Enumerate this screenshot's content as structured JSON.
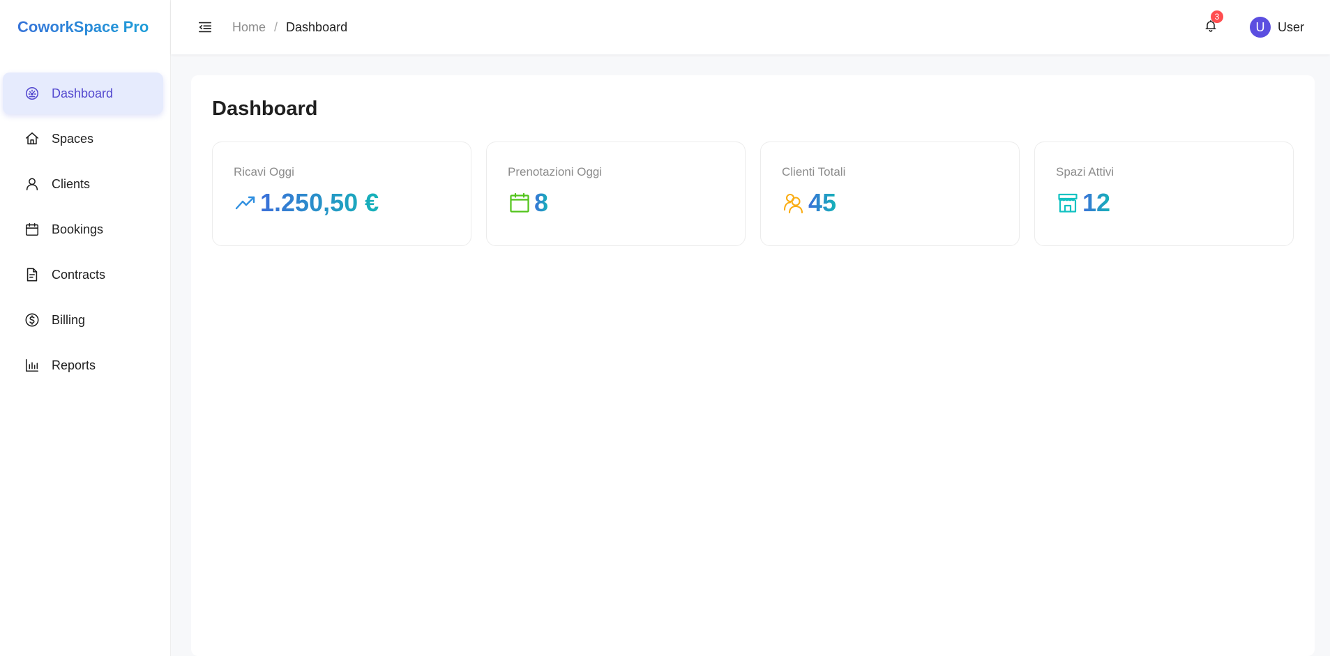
{
  "app": {
    "brand": "CoworkSpace Pro"
  },
  "sidebar": {
    "items": [
      {
        "label": "Dashboard",
        "icon": "dashboard-gauge-icon",
        "active": true
      },
      {
        "label": "Spaces",
        "icon": "home-icon"
      },
      {
        "label": "Clients",
        "icon": "user-icon"
      },
      {
        "label": "Bookings",
        "icon": "calendar-icon"
      },
      {
        "label": "Contracts",
        "icon": "document-icon"
      },
      {
        "label": "Billing",
        "icon": "dollar-circle-icon"
      },
      {
        "label": "Reports",
        "icon": "bar-chart-icon"
      }
    ]
  },
  "header": {
    "breadcrumb": {
      "home": "Home",
      "separator": "/",
      "current": "Dashboard"
    },
    "notifications": {
      "count": "3"
    },
    "user": {
      "initial": "U",
      "name": "User"
    }
  },
  "page": {
    "title": "Dashboard",
    "stats": [
      {
        "label": "Ricavi Oggi",
        "value": "1.250,50 €",
        "icon": "trending-up-icon",
        "icon_color": "#2f8fe0"
      },
      {
        "label": "Prenotazioni Oggi",
        "value": "8",
        "icon": "calendar-icon",
        "icon_color": "#52c41a"
      },
      {
        "label": "Clienti Totali",
        "value": "45",
        "icon": "users-icon",
        "icon_color": "#faad14"
      },
      {
        "label": "Spazi Attivi",
        "value": "12",
        "icon": "shop-icon",
        "icon_color": "#13c2c2"
      }
    ]
  },
  "colors": {
    "accent": "#5449cf",
    "active_bg": "#e6ebfd",
    "badge": "#ff4d4f",
    "avatar": "#5b4ee0",
    "gradient_start": "#3b6fd9",
    "gradient_end": "#15b3b8"
  }
}
